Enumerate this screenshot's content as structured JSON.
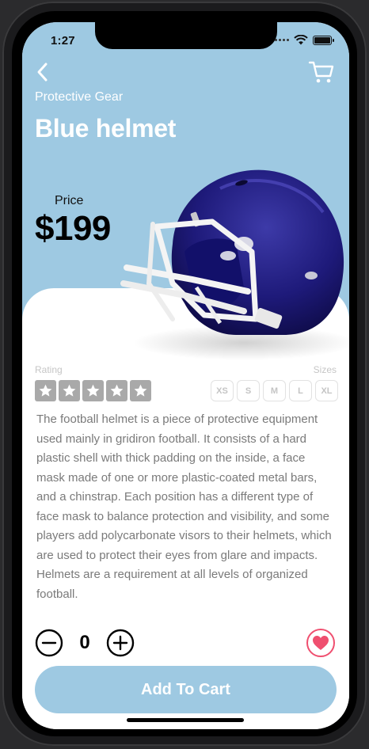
{
  "status_bar": {
    "time": "1:27"
  },
  "product": {
    "category": "Protective Gear",
    "name": "Blue helmet",
    "price_label": "Price",
    "price": "$199",
    "description": "The football helmet is a piece of protective equipment used mainly in gridiron football. It consists of a hard plastic shell with thick padding on the inside, a face mask made of one or more plastic-coated metal bars, and a chinstrap. Each position has a different type of face mask to balance protection and visibility, and some players add polycarbonate visors to their helmets, which are used to protect their eyes from glare and impacts. Helmets are a requirement at all levels of organized football."
  },
  "rating": {
    "label": "Rating",
    "stars": 5
  },
  "sizes": {
    "label": "Sizes",
    "options": [
      "XS",
      "S",
      "M",
      "L",
      "XL"
    ]
  },
  "quantity": {
    "value": "0"
  },
  "actions": {
    "add_to_cart": "Add To Cart"
  },
  "colors": {
    "accent": "#9ec9e2",
    "favorite": "#ef4f6f",
    "star_box": "#a9a9a9"
  },
  "icons": {
    "back": "chevron-left-icon",
    "cart": "shopping-cart-icon",
    "minus": "minus-circle-icon",
    "plus": "plus-circle-icon",
    "favorite": "heart-icon",
    "star": "star-icon"
  }
}
